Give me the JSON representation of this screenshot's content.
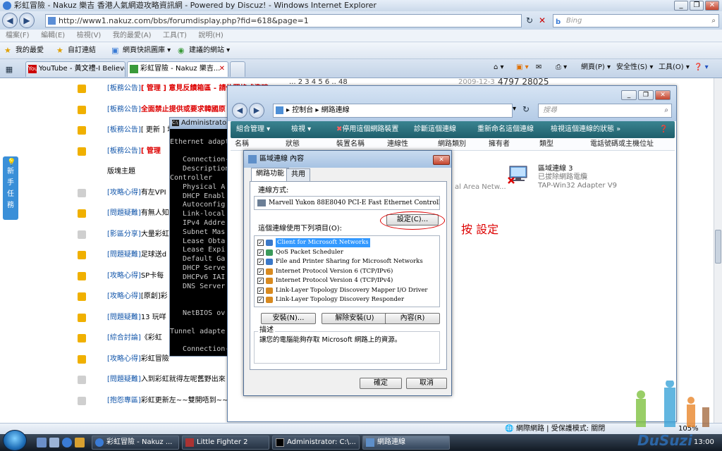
{
  "browser": {
    "title": "彩虹冒險 - Nakuz 樂吉 香港人氣網遊攻略資訊網 - Powered by Discuz! - Windows Internet Explorer",
    "address": "http://www1.nakuz.com/bbs/forumdisplay.php?fid=618&page=1",
    "search_placeholder": "Bing",
    "menu": [
      "檔案(F)",
      "編輯(E)",
      "檢視(V)",
      "我的最愛(A)",
      "工具(T)",
      "說明(H)"
    ],
    "favorites": [
      "我的最愛",
      "自訂連結",
      "網頁快訊圖庫",
      "建議的網站"
    ],
    "tabs": [
      "YouTube - 黃文禮-I Believe",
      "彩虹冒險 - Nakuz 樂吉..."
    ],
    "commands": [
      "網頁(P)",
      "安全性(S)",
      "工具(O)"
    ],
    "status_zone": "網際網路 | 受保護模式: 關閉",
    "zoom": "105%"
  },
  "forum": {
    "sidebar_label": "新手任務",
    "pagination": "... 2 3 4 5 6 .. 48",
    "top_date": "2009-12-3",
    "top_stats": "4797 28025",
    "rows": [
      {
        "cat": "[板務公告]",
        "title": "[ 管理 ] 意見反饋箱區 - 請依照格式準確",
        "red": true
      },
      {
        "cat": "[板務公告]",
        "title": "全面禁止提供或要求韓國原",
        "red": true
      },
      {
        "cat": "[板務公告]",
        "title": "[ 更新 ] 增",
        "red": false
      },
      {
        "cat": "[板務公告]",
        "title": "[ 管理",
        "red": true
      },
      {
        "cat": "",
        "title": "版塊主題",
        "red": false
      },
      {
        "cat": "[攻略心得]",
        "title": "有左VPI",
        "red": false
      },
      {
        "cat": "[問題疑難]",
        "title": "有無人知",
        "red": false
      },
      {
        "cat": "[影區分享]",
        "title": "大量彩虹",
        "red": false
      },
      {
        "cat": "[問題疑難]",
        "title": "足球送d",
        "red": false
      },
      {
        "cat": "[攻略心得]",
        "title": "SP卡每",
        "red": false
      },
      {
        "cat": "[攻略心得]",
        "title": "[原創]彩",
        "red": false
      },
      {
        "cat": "[問題疑難]",
        "title": "13 玩咩",
        "red": false
      },
      {
        "cat": "[綜合討論]",
        "title": "《彩虹",
        "red": false
      },
      {
        "cat": "[攻略心得]",
        "title": "彩虹冒險",
        "red": false
      },
      {
        "cat": "[問題疑難]",
        "title": "入到彩虹就得左呢舊野出來",
        "red": false
      },
      {
        "cat": "[抱怨專區]",
        "title": "彩虹更新左~~雙開唔到~~",
        "red": false
      }
    ]
  },
  "cmd": {
    "title": "Administrator: C:\\Windows\\system32\\cmd.exe",
    "lines": [
      "",
      "Ethernet adapter",
      "",
      "   Connection-",
      "   Description",
      "Controller",
      "   Physical A",
      "   DHCP Enabl",
      "   Autoconfig",
      "   Link-local",
      "   IPv4 Addre",
      "   Subnet Mas",
      "   Lease Obta",
      "   Lease Expi",
      "   Default Ga",
      "   DHCP Serve",
      "   DHCPv6 IAI",
      "   DNS Server",
      "",
      "",
      "   NetBIOS ov",
      "",
      "Tunnel adapte",
      "",
      "   Connection-"
    ]
  },
  "netconn": {
    "breadcrumb": "▸ 控制台 ▸ 網路連線",
    "search_placeholder": "搜尋",
    "toolbar": [
      "組合管理 ▾",
      "檢視 ▾",
      "停用這個網路裝置",
      "診斷這個連線",
      "重新命名這個連線",
      "檢視這個連線的狀態 »"
    ],
    "columns": [
      "名稱",
      "狀態",
      "裝置名稱",
      "連線性",
      "網路類別",
      "擁有者",
      "類型",
      "電話號碼或主機位址"
    ],
    "partial_item": "al Area Netw...",
    "item": {
      "name": "區域連線 3",
      "status": "已拔除網路電纜",
      "device": "TAP-Win32 Adapter V9"
    }
  },
  "dialog": {
    "title": "區域連線 內容",
    "tabs": [
      "網路功能",
      "共用"
    ],
    "connect_using_label": "連線方式:",
    "adapter": "Marvell Yukon 88E8040 PCI-E Fast Ethernet Controller",
    "configure_button": "設定(C)...",
    "items_label": "這個連線使用下列項目(O):",
    "items": [
      "Client for Microsoft Networks",
      "QoS Packet Scheduler",
      "File and Printer Sharing for Microsoft Networks",
      "Internet Protocol Version 6 (TCP/IPv6)",
      "Internet Protocol Version 4 (TCP/IPv4)",
      "Link-Layer Topology Discovery Mapper I/O Driver",
      "Link-Layer Topology Discovery Responder"
    ],
    "install_button": "安裝(N)...",
    "uninstall_button": "解除安裝(U)",
    "properties_button": "內容(R)",
    "description_label": "描述",
    "description_text": "讓您的電腦能夠存取 Microsoft 網路上的資源。",
    "ok_button": "確定",
    "cancel_button": "取消"
  },
  "annotation": "按 設定",
  "taskbar": {
    "buttons": [
      "彩虹冒險 - Nakuz ...",
      "Little Fighter 2",
      "Administrator: C:\\...",
      "網路連線"
    ],
    "clock": "13:00"
  },
  "watermark": "DuSuzi",
  "colors": {
    "accent_red": "#dd0000",
    "link_blue": "#1155aa",
    "explorer_toolbar": "#2f7380"
  }
}
